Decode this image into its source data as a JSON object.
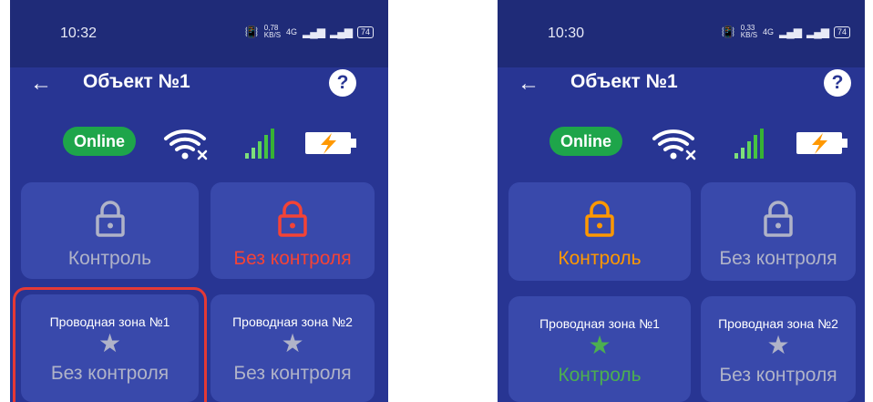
{
  "colors": {
    "background": "#283593",
    "tile": "#3949ab",
    "online": "#1ea54a",
    "control_inactive": "#b0b3c8",
    "no_control_active": "#f44336",
    "control_active": "#ff9800",
    "zone_controlled": "#4caf50",
    "highlight": "#e53935"
  },
  "left": {
    "status": {
      "time": "10:32",
      "speed_value": "0,78",
      "speed_unit": "KB/S",
      "network": "4G",
      "battery": "74"
    },
    "appbar": {
      "back": "←",
      "title": "Объект №1",
      "help": "?"
    },
    "indicators": {
      "online": "Online",
      "wifi_icon": "wifi-off-icon",
      "signal_icon": "cellular-signal-icon",
      "battery_icon": "battery-charging-icon"
    },
    "tiles": {
      "control": {
        "label": "Контроль",
        "icon": "lock-icon",
        "state": "inactive"
      },
      "no_control": {
        "label": "Без контроля",
        "icon": "lock-icon",
        "state": "active"
      }
    },
    "zones": [
      {
        "name": "Проводная зона №1",
        "state": "Без контроля",
        "icon": "star-icon",
        "highlighted": true
      },
      {
        "name": "Проводная зона №2",
        "state": "Без контроля",
        "icon": "star-icon"
      }
    ]
  },
  "right": {
    "status": {
      "time": "10:30",
      "speed_value": "0,33",
      "speed_unit": "KB/S",
      "network": "4G",
      "battery": "74"
    },
    "appbar": {
      "back": "←",
      "title": "Объект №1",
      "help": "?"
    },
    "indicators": {
      "online": "Online",
      "wifi_icon": "wifi-off-icon",
      "signal_icon": "cellular-signal-icon",
      "battery_icon": "battery-charging-icon"
    },
    "tiles": {
      "control": {
        "label": "Контроль",
        "icon": "lock-icon",
        "state": "active"
      },
      "no_control": {
        "label": "Без контроля",
        "icon": "lock-icon",
        "state": "inactive"
      }
    },
    "zones": [
      {
        "name": "Проводная зона №1",
        "state": "Контроль",
        "icon": "star-icon"
      },
      {
        "name": "Проводная зона №2",
        "state": "Без контроля",
        "icon": "star-icon"
      }
    ]
  }
}
